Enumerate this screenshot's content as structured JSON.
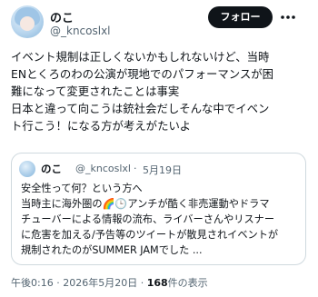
{
  "post": {
    "author_name": "のこ",
    "author_handle": "@_kncoslxl",
    "follow_label": "フォロー",
    "body": "イベント規制は正しくないかもしれないけど、当時\nENとくろのわの公演が現地でのパフォーマンスが困\n難になって変更されたことは事実\n日本と違って向こうは銃社会だしそんな中でイベン\nト行こう！になる方が考えがたいよ"
  },
  "quote": {
    "author_name": "のこ",
    "author_handle": "@_kncoslxl",
    "separator": "·",
    "date": "5月19日",
    "text": "安全性って何？という方へ\n当時主に海外圏の🌈🕒アンチが酷く非売運動やドラマ\nチューバーによる情報の流布、ライバーさんやリスナー\nに危害を加える/予告等のツイートが散見されイベントが\n規制されたのがSUMMER JAMでした ..."
  },
  "meta": {
    "time": "午後0:16",
    "dot1": "·",
    "date": "2026年5月20日",
    "dot2": "·",
    "views": "168",
    "views_label": "件の表示"
  },
  "icons": {
    "more": "more-icon"
  }
}
